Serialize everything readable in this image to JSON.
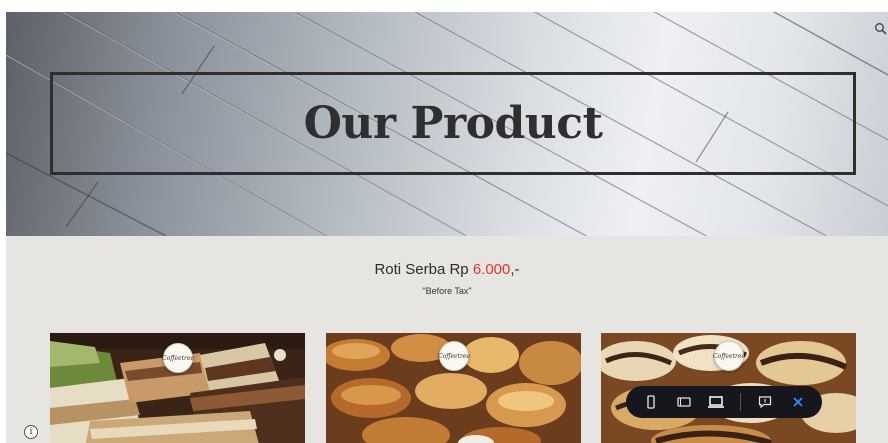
{
  "hero": {
    "title": "Our Product"
  },
  "header": {
    "search_icon": "search-icon"
  },
  "pricing": {
    "prefix": "Roti Serba Rp ",
    "price": "6.000",
    "suffix": ",-",
    "note": "\"Before Tax\"",
    "price_color": "#e8332d"
  },
  "products": [
    {
      "logo_text": "Coffeetree",
      "image": "layered-cake-slices"
    },
    {
      "logo_text": "Coffeetree",
      "image": "assorted-bread-rolls"
    },
    {
      "logo_text": "Coffeetree",
      "image": "chocolate-swirl-buns"
    }
  ],
  "toolbar": {
    "buttons": [
      "mobile-view-icon",
      "tablet-view-icon",
      "desktop-view-icon",
      "comment-icon",
      "close-icon"
    ],
    "background": "#15171c",
    "accent": "#3b8cff"
  },
  "info": {
    "label": "i"
  }
}
